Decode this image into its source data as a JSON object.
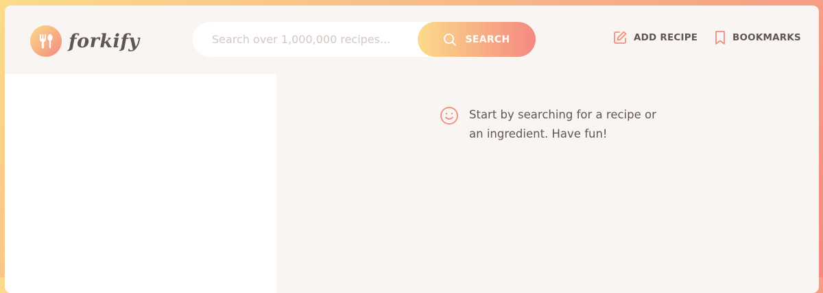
{
  "logo": {
    "text": "forkify",
    "icon": "fork-spoon-icon"
  },
  "search": {
    "placeholder": "Search over 1,000,000 recipes...",
    "value": "",
    "button_label": "SEARCH",
    "icon": "search-icon"
  },
  "nav": {
    "add_recipe": {
      "label": "ADD RECIPE",
      "icon": "edit-icon"
    },
    "bookmarks": {
      "label": "BOOKMARKS",
      "icon": "bookmark-icon"
    }
  },
  "recipe_view": {
    "message": "Start by searching for a recipe or an ingredient. Have fun!",
    "icon": "smile-icon"
  },
  "colors": {
    "gradient_start": "#fbdb89",
    "gradient_end": "#f48982",
    "accent": "#f38e82",
    "text": "#615551",
    "placeholder": "#d3c7c3",
    "background": "#f9f5f3"
  }
}
